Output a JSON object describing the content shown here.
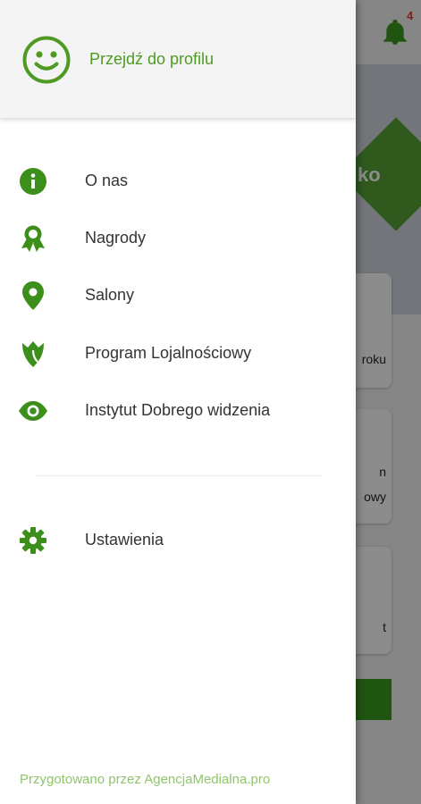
{
  "colors": {
    "accent": "#4f9a24",
    "icon_green": "#3d8f1c",
    "footer_text": "#8fc56b",
    "badge": "#e53935"
  },
  "background": {
    "notification_count": "4",
    "hero_text": "ko",
    "card_fragments": [
      "roku",
      "n",
      "owy",
      "t"
    ]
  },
  "drawer": {
    "profile": {
      "icon": "smiley-icon",
      "label": "Przejdź do profilu"
    },
    "items": [
      {
        "icon": "info-icon",
        "label": "O nas"
      },
      {
        "icon": "award-ribbon-icon",
        "label": "Nagrody"
      },
      {
        "icon": "location-pin-icon",
        "label": "Salony"
      },
      {
        "icon": "tulip-icon",
        "label": "Program Lojalnościowy"
      },
      {
        "icon": "eye-icon",
        "label": "Instytut Dobrego widzenia"
      }
    ],
    "settings": {
      "icon": "gear-icon",
      "label": "Ustawienia"
    },
    "footer": "Przygotowano przez AgencjaMedialna.pro"
  }
}
